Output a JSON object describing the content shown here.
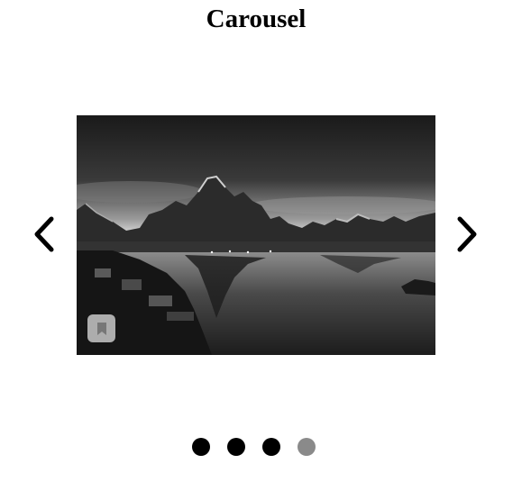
{
  "page": {
    "title": "Carousel"
  },
  "carousel": {
    "prev_icon": "chevron-left-icon",
    "next_icon": "chevron-right-icon",
    "slide_icon": "bookmark-icon",
    "dot_count": 4,
    "active_index": 3,
    "colors": {
      "dot": "#000000",
      "dot_active": "#8a8a8a"
    }
  }
}
